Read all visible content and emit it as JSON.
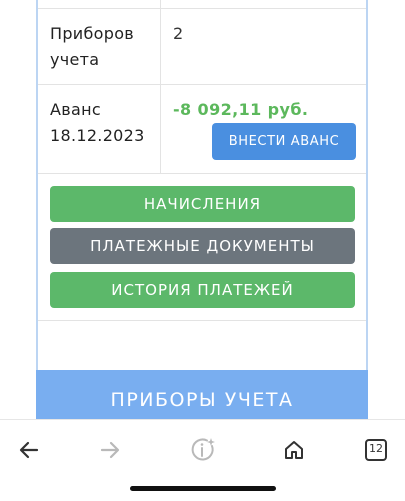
{
  "table": {
    "meters_label": "Приборов учета",
    "meters_label_line1": "Приборов",
    "meters_label_line2": "учета",
    "meters_value": "2",
    "advance_label_line1": "Аванс",
    "advance_label_line2": "18.12.2023",
    "advance_value": "-8 092,11 руб."
  },
  "buttons": {
    "deposit_advance": "ВНЕСТИ АВАНС",
    "accruals": "НАЧИСЛЕНИЯ",
    "payment_documents": "ПЛАТЕЖНЫЕ ДОКУМЕНТЫ",
    "payment_history": "ИСТОРИЯ ПЛАТЕЖЕЙ"
  },
  "section": {
    "meters_header": "ПРИБОРЫ УЧЕТА"
  },
  "browser_bar": {
    "tab_count": "12",
    "icons": [
      "back-arrow-icon",
      "forward-arrow-icon",
      "info-sparkle-icon",
      "home-icon",
      "tabs-icon"
    ]
  },
  "colors": {
    "accent_blue": "#4a8fe0",
    "green": "#5cb86a",
    "gray": "#6c757d",
    "header_blue": "#79aef0",
    "amount_green": "#5cb85c"
  }
}
